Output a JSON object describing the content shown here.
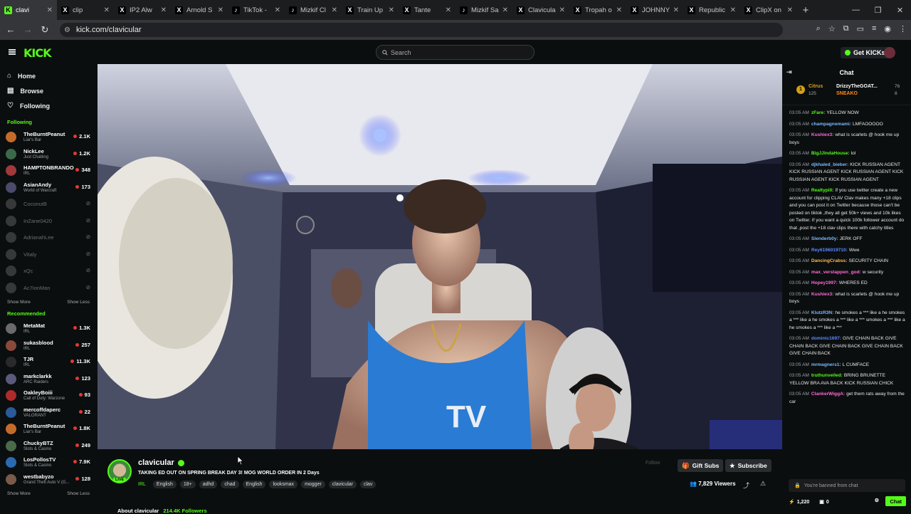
{
  "browser": {
    "tabs": [
      {
        "title": "clavi",
        "icon": "K",
        "icon_bg": "#53fc18",
        "icon_fg": "#000000",
        "active": true
      },
      {
        "title": "clip",
        "icon": "X",
        "icon_bg": "#000000",
        "icon_fg": "#ffffff"
      },
      {
        "title": "IP2 Alw",
        "icon": "X",
        "icon_bg": "#000000",
        "icon_fg": "#ffffff"
      },
      {
        "title": "Arnold S",
        "icon": "X",
        "icon_bg": "#000000",
        "icon_fg": "#ffffff"
      },
      {
        "title": "TikTok -",
        "icon": "♪",
        "icon_bg": "#000000",
        "icon_fg": "#ffffff"
      },
      {
        "title": "Mizkif Cl",
        "icon": "♪",
        "icon_bg": "#000000",
        "icon_fg": "#ffffff"
      },
      {
        "title": "Train Up",
        "icon": "X",
        "icon_bg": "#000000",
        "icon_fg": "#ffffff"
      },
      {
        "title": "Tante",
        "icon": "X",
        "icon_bg": "#000000",
        "icon_fg": "#ffffff"
      },
      {
        "title": "Mizkif Sa",
        "icon": "♪",
        "icon_bg": "#000000",
        "icon_fg": "#ffffff"
      },
      {
        "title": "Clavicula",
        "icon": "X",
        "icon_bg": "#000000",
        "icon_fg": "#ffffff"
      },
      {
        "title": "Tropah o",
        "icon": "X",
        "icon_bg": "#000000",
        "icon_fg": "#ffffff"
      },
      {
        "title": "JOHNNY o",
        "icon": "X",
        "icon_bg": "#000000",
        "icon_fg": "#ffffff"
      },
      {
        "title": "Republic",
        "icon": "X",
        "icon_bg": "#000000",
        "icon_fg": "#ffffff"
      },
      {
        "title": "ClipX on",
        "icon": "X",
        "icon_bg": "#000000",
        "icon_fg": "#ffffff"
      }
    ],
    "url": "kick.com/clavicular"
  },
  "site": {
    "logo": "KICK",
    "search_placeholder": "Search",
    "get_kicks": "Get KICKs"
  },
  "sidebar": {
    "nav": [
      {
        "label": "Home",
        "icon": "home-icon"
      },
      {
        "label": "Browse",
        "icon": "browse-icon"
      },
      {
        "label": "Following",
        "icon": "heart-icon"
      }
    ],
    "following_title": "Following",
    "following": [
      {
        "name": "TheBurntPeanut",
        "game": "Liar's Bar",
        "viewers": "2.1K",
        "color": "#c46b2a"
      },
      {
        "name": "NickLee",
        "game": "Just Chatting",
        "viewers": "1.2K",
        "color": "#3b6a4a"
      },
      {
        "name": "HAMPTONBRANDO",
        "game": "IRL",
        "viewers": "348",
        "color": "#a03a3a"
      },
      {
        "name": "AsianAndy",
        "game": "World of Warcraft",
        "viewers": "173",
        "color": "#4a4a6a"
      },
      {
        "name": "CoconutB",
        "game": "",
        "viewers": "",
        "color": "#777777",
        "offline": true
      },
      {
        "name": "InZane0420",
        "game": "",
        "viewers": "",
        "color": "#777777",
        "offline": true
      },
      {
        "name": "AdrianahLee",
        "game": "",
        "viewers": "",
        "color": "#777777",
        "offline": true
      },
      {
        "name": "Vitaly",
        "game": "",
        "viewers": "",
        "color": "#777777",
        "offline": true
      },
      {
        "name": "xQc",
        "game": "",
        "viewers": "",
        "color": "#777777",
        "offline": true
      },
      {
        "name": "Ac7ionMan",
        "game": "",
        "viewers": "",
        "color": "#777777",
        "offline": true
      }
    ],
    "show_more": "Show More",
    "show_less": "Show Less",
    "recommended_title": "Recommended",
    "recommended": [
      {
        "name": "MetaMat",
        "game": "IRL",
        "viewers": "1.3K",
        "color": "#6a6a6a"
      },
      {
        "name": "sukasblood",
        "game": "IRL",
        "viewers": "257",
        "color": "#8a4a3a"
      },
      {
        "name": "TJR",
        "game": "IRL",
        "viewers": "11.3K",
        "color": "#2a2a2a"
      },
      {
        "name": "markclarkk",
        "game": "ARC Raiders",
        "viewers": "123",
        "color": "#5a5a7a"
      },
      {
        "name": "OakleyBoiii",
        "game": "Call of Duty: Warzone",
        "viewers": "93",
        "color": "#b02a2a"
      },
      {
        "name": "mercoffdaperc",
        "game": "VALORANT",
        "viewers": "22",
        "color": "#2a5a9a"
      },
      {
        "name": "TheBurntPeanut",
        "game": "Liar's Bar",
        "viewers": "1.8K",
        "color": "#c46b2a"
      },
      {
        "name": "ChuckyBTZ",
        "game": "Slots & Casino",
        "viewers": "249",
        "color": "#4a6a4a"
      },
      {
        "name": "LosPollosTV",
        "game": "Slots & Casino",
        "viewers": "7.9K",
        "color": "#2a6ab0"
      },
      {
        "name": "westbabyzo",
        "game": "Grand Theft Auto V (G...",
        "viewers": "128",
        "color": "#7a5a4a"
      }
    ]
  },
  "stream": {
    "name": "clavicular",
    "live_badge": "LIVE",
    "title": "TAKING ED OUT ON SPRING BREAK DAY 3! MOG WORLD ORDER IN 2 Days",
    "category": "IRL",
    "tags": [
      "English",
      "18+",
      "adhd",
      "chad",
      "English",
      "looksmax",
      "mogger",
      "clavicular",
      "clav"
    ],
    "follow_label": "Follow",
    "gift_subs": "Gift Subs",
    "subscribe": "Subscribe",
    "viewers": "7,829 Viewers",
    "about_label": "About clavicular",
    "followers": "214.4K Followers"
  },
  "chat": {
    "title": "Chat",
    "pinned": {
      "user1": "Citrus",
      "count1": "125",
      "user2": "DrizzyTheGOAT...",
      "count2": "76",
      "user3": "SNEAKO",
      "count3": "8"
    },
    "messages": [
      {
        "time": "03:05 AM",
        "user": "zFare:",
        "color": "#53fc18",
        "text": "YELLOW NOW"
      },
      {
        "time": "03:05 AM",
        "user": "champagnemami:",
        "color": "#7ab8ff",
        "text": "LMFAOOOOO"
      },
      {
        "time": "03:05 AM",
        "user": "Kushiex3:",
        "color": "#ff6ad5",
        "text": "what is scarlets @ hook me up boys"
      },
      {
        "time": "03:05 AM",
        "user": "BigJJindaHouse:",
        "color": "#53fc18",
        "text": "lol"
      },
      {
        "time": "03:05 AM",
        "user": "djkhaled_bieber:",
        "color": "#7ab8ff",
        "text": "KICK RUSSIAN AGENT KICK RUSSIAN AGENT KICK RUSSIAN AGENT KICK RUSSIAN AGENT KICK RUSSIAN AGENT"
      },
      {
        "time": "03:05 AM",
        "user": "Realtypill:",
        "color": "#53fc18",
        "text": "If you use twitter create a new account for clipping CLAV Clav makes many +18 clips and you can post it on Twitter because those can't be posted on tiktok ,they all get 50k+ views and 10k likes on Twitter. If you want a quick 100k follower account do that ,post the +18 clav clips there with catchy titles"
      },
      {
        "time": "03:05 AM",
        "user": "Slenderb0y:",
        "color": "#7ab8ff",
        "text": "JERK OFF"
      },
      {
        "time": "03:05 AM",
        "user": "Rey6196019710:",
        "color": "#5a8aff",
        "text": "Wwe"
      },
      {
        "time": "03:05 AM",
        "user": "DancingCrabss:",
        "color": "#ffb84d",
        "text": "SECURITY CHAIN"
      },
      {
        "time": "03:05 AM",
        "user": "max_verstappen_god:",
        "color": "#ff6ad5",
        "text": "w security"
      },
      {
        "time": "03:05 AM",
        "user": "Hopey1997:",
        "color": "#ff6ad5",
        "text": "WHERES ED"
      },
      {
        "time": "03:05 AM",
        "user": "Kushiex3:",
        "color": "#ff6ad5",
        "text": "what is scarlets @ hook me up boys"
      },
      {
        "time": "03:05 AM",
        "user": "KlutzR3N:",
        "color": "#7ab8ff",
        "text": "he smokes a *** like a he smokes a *** like a he smokes a *** like a *** smokes a *** like a he smokes a *** like a ***"
      },
      {
        "time": "03:05 AM",
        "user": "dominic1697:",
        "color": "#5a8aff",
        "text": "GIVE CHAIN BACK GIVE CHAIN BACK GIVE CHAIN BACK GIVE CHAIN BACK GIVE CHAIN BACK"
      },
      {
        "time": "03:05 AM",
        "user": "mrmagners1:",
        "color": "#7ab8ff",
        "text": "L CUMFACE"
      },
      {
        "time": "03:05 AM",
        "user": "truthunveiled:",
        "color": "#53fc18",
        "text": "BRING BRUNETTE YELLOW BRA AVA BACK KICK RUSSIAN CHICK"
      },
      {
        "time": "03:05 AM",
        "user": "ClankerWiggA:",
        "color": "#ff6ad5",
        "text": "get them rats away from the car"
      }
    ],
    "banned_placeholder": "You're banned from chat",
    "kicks": "1,220",
    "zero": "0",
    "chat_button": "Chat"
  }
}
